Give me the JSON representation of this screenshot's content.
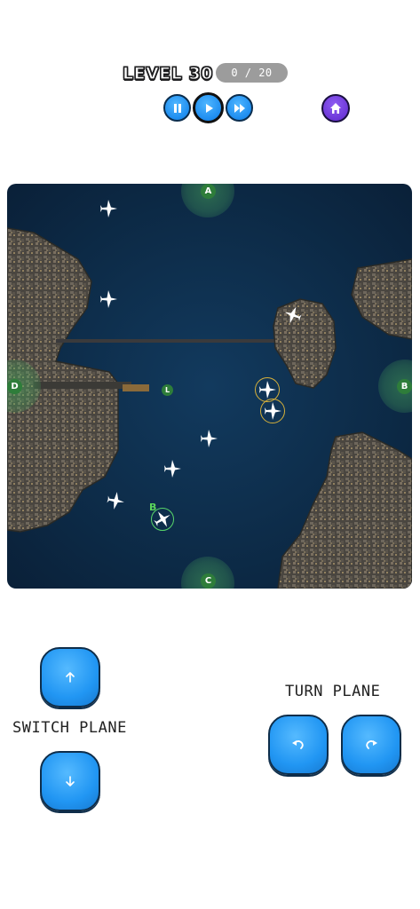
{
  "header": {
    "level_label": "LEVEL 30",
    "progress": "0 / 20",
    "pause_icon": "pause-icon",
    "play_icon": "play-icon",
    "fast_forward_icon": "fast-forward-icon",
    "home_icon": "home-icon"
  },
  "map": {
    "zones": {
      "a": "A",
      "b": "B",
      "c": "C",
      "d": "D"
    },
    "airport_label": "L",
    "plane_marker_label": "B"
  },
  "controls": {
    "switch_plane_label": "SWITCH PLANE",
    "turn_plane_label": "TURN PLANE"
  },
  "colors": {
    "button_blue": "#2196f3",
    "home_purple": "#6a34d6",
    "zone_green": "#2e7d3a",
    "water": "#0d2c49"
  }
}
